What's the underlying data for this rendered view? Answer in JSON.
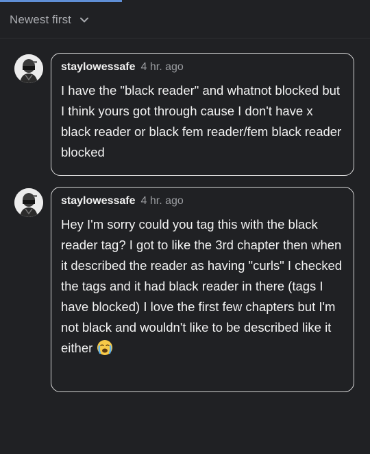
{
  "sort": {
    "label": "Newest first",
    "icon": "chevron-down-icon"
  },
  "comments": [
    {
      "username": "staylowessafe",
      "time": "4 hr. ago",
      "text": "I have the \"black reader\" and whatnot blocked but I think yours got through cause I don't have x black reader or black fem reader/fem black reader blocked"
    },
    {
      "username": "staylowessafe",
      "time": "4 hr. ago",
      "text": "Hey I'm sorry could you tag this with the black reader tag? I got to like the 3rd chapter then when it described the reader as having \"curls\" I checked the tags and it had black reader in there (tags I have blocked) I love the first few chapters but I'm not black and wouldn't like to be described like it either",
      "emoji": "crying-face-emoji"
    }
  ],
  "colors": {
    "background": "#202124",
    "accent": "#5f8fd6",
    "bubble_border": "#d9d9d9",
    "muted_text": "#9a9ca0"
  }
}
